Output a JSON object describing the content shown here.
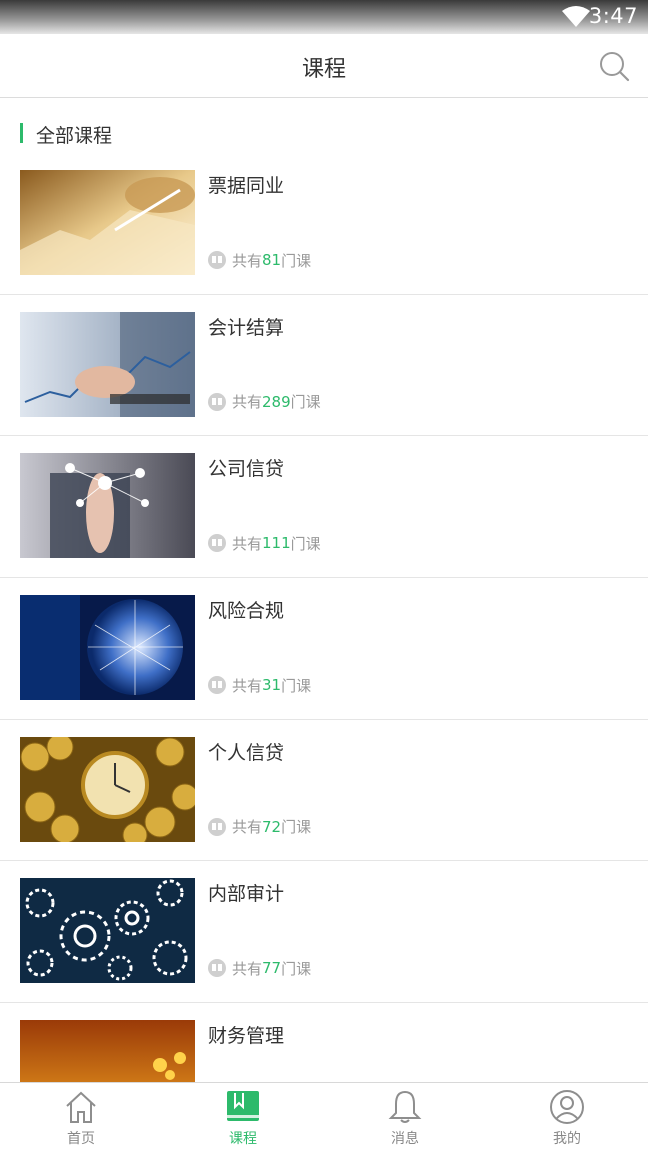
{
  "status_bar": {
    "time": "3:47",
    "wifi_icon": "wifi-icon"
  },
  "header": {
    "title": "课程",
    "search_icon": "search-icon"
  },
  "section": {
    "title": "全部课程",
    "accent": "#2dba6b"
  },
  "courses": [
    {
      "name": "票据同业",
      "prefix": "共有",
      "count": "81",
      "suffix": "门课",
      "thumb": "finance-hands-image"
    },
    {
      "name": "会计结算",
      "prefix": "共有",
      "count": "289",
      "suffix": "门课",
      "thumb": "accounting-chart-image"
    },
    {
      "name": "公司信贷",
      "prefix": "共有",
      "count": "111",
      "suffix": "门课",
      "thumb": "network-touch-image"
    },
    {
      "name": "风险合规",
      "prefix": "共有",
      "count": "31",
      "suffix": "门课",
      "thumb": "globe-network-image"
    },
    {
      "name": "个人信贷",
      "prefix": "共有",
      "count": "72",
      "suffix": "门课",
      "thumb": "gold-coins-clock-image"
    },
    {
      "name": "内部审计",
      "prefix": "共有",
      "count": "77",
      "suffix": "门课",
      "thumb": "gears-image"
    },
    {
      "name": "财务管理",
      "prefix": "",
      "count": "",
      "suffix": "",
      "thumb": "golden-flowers-image"
    }
  ],
  "nav": {
    "home": {
      "label": "首页",
      "icon": "home-icon"
    },
    "courses": {
      "label": "课程",
      "icon": "bookmark-book-icon"
    },
    "messages": {
      "label": "消息",
      "icon": "bell-icon"
    },
    "profile": {
      "label": "我的",
      "icon": "user-icon"
    }
  },
  "colors": {
    "accent": "#2dba6b",
    "text": "#333333",
    "muted": "#999999"
  }
}
